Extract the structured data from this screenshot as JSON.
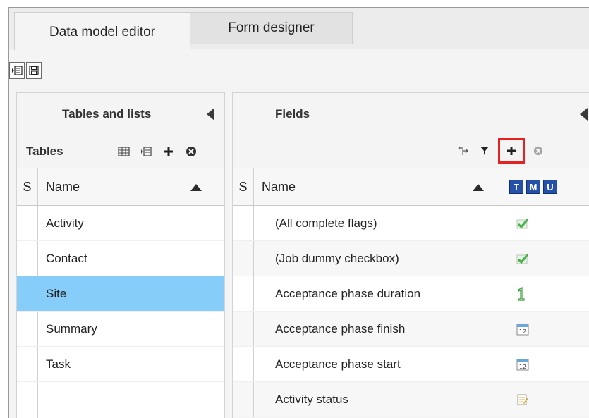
{
  "tabs": [
    {
      "label": "Data model editor",
      "active": true
    },
    {
      "label": "Form designer",
      "active": false
    }
  ],
  "toolbar": {
    "buttons": [
      {
        "icon": "import-icon"
      },
      {
        "icon": "save-icon"
      }
    ]
  },
  "left_panel": {
    "title": "Tables and lists",
    "sub_label": "Tables",
    "column_s": "S",
    "column_name": "Name",
    "rows": [
      "Activity",
      "Contact",
      "Site",
      "Summary",
      "Task"
    ],
    "selected_row": "Site"
  },
  "right_panel": {
    "title": "Fields",
    "column_s": "S",
    "column_name": "Name",
    "type_badges": [
      "T",
      "M",
      "U"
    ],
    "rows": [
      {
        "name": "(All complete flags)",
        "type_icon": "checkbox-icon"
      },
      {
        "name": "(Job dummy checkbox)",
        "type_icon": "checkbox-icon"
      },
      {
        "name": "Acceptance phase duration",
        "type_icon": "number-icon"
      },
      {
        "name": "Acceptance phase finish",
        "type_icon": "calendar-icon",
        "cal_num": "12"
      },
      {
        "name": "Acceptance phase start",
        "type_icon": "calendar-icon",
        "cal_num": "12"
      },
      {
        "name": "Activity status",
        "type_icon": "notepad-icon"
      }
    ]
  },
  "colors": {
    "selected_row": "#87cdf9",
    "highlight_border": "#e52222",
    "badge_bg": "#2552a8"
  }
}
